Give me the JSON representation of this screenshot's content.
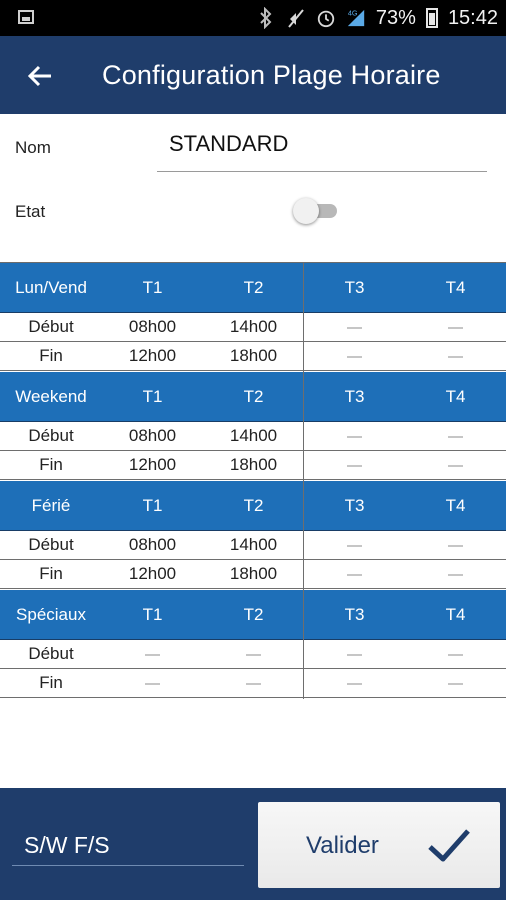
{
  "status_bar": {
    "battery_percent": "73%",
    "time": "15:42",
    "network": "4G",
    "icons": [
      "image-icon",
      "bluetooth-icon",
      "mute-icon",
      "alarm-icon",
      "signal-icon",
      "battery-icon"
    ]
  },
  "app_bar": {
    "title": "Configuration Plage Horaire",
    "back_icon": "arrow-left-icon"
  },
  "form": {
    "nom_label": "Nom",
    "nom_value": "STANDARD",
    "etat_label": "Etat",
    "etat_on": false
  },
  "schedule": {
    "dash": "—",
    "sections": [
      {
        "name": "Lun/Vend",
        "cols": [
          "T1",
          "T2",
          "T3",
          "T4"
        ],
        "rows": [
          {
            "label": "Début",
            "values": [
              "08h00",
              "14h00",
              "—",
              "—"
            ]
          },
          {
            "label": "Fin",
            "values": [
              "12h00",
              "18h00",
              "—",
              "—"
            ]
          }
        ]
      },
      {
        "name": "Weekend",
        "cols": [
          "T1",
          "T2",
          "T3",
          "T4"
        ],
        "rows": [
          {
            "label": "Début",
            "values": [
              "08h00",
              "14h00",
              "—",
              "—"
            ]
          },
          {
            "label": "Fin",
            "values": [
              "12h00",
              "18h00",
              "—",
              "—"
            ]
          }
        ]
      },
      {
        "name": "Férié",
        "cols": [
          "T1",
          "T2",
          "T3",
          "T4"
        ],
        "rows": [
          {
            "label": "Début",
            "values": [
              "08h00",
              "14h00",
              "—",
              "—"
            ]
          },
          {
            "label": "Fin",
            "values": [
              "12h00",
              "18h00",
              "—",
              "—"
            ]
          }
        ]
      },
      {
        "name": "Spéciaux",
        "cols": [
          "T1",
          "T2",
          "T3",
          "T4"
        ],
        "rows": [
          {
            "label": "Début",
            "values": [
              "—",
              "—",
              "—",
              "—"
            ]
          },
          {
            "label": "Fin",
            "values": [
              "—",
              "—",
              "—",
              "—"
            ]
          }
        ]
      }
    ]
  },
  "bottom": {
    "code_value": "S/W F/S",
    "validate_label": "Valider",
    "validate_icon": "check-icon"
  },
  "colors": {
    "primary_dark": "#1f3d6b",
    "header_blue": "#1e6fb8"
  }
}
